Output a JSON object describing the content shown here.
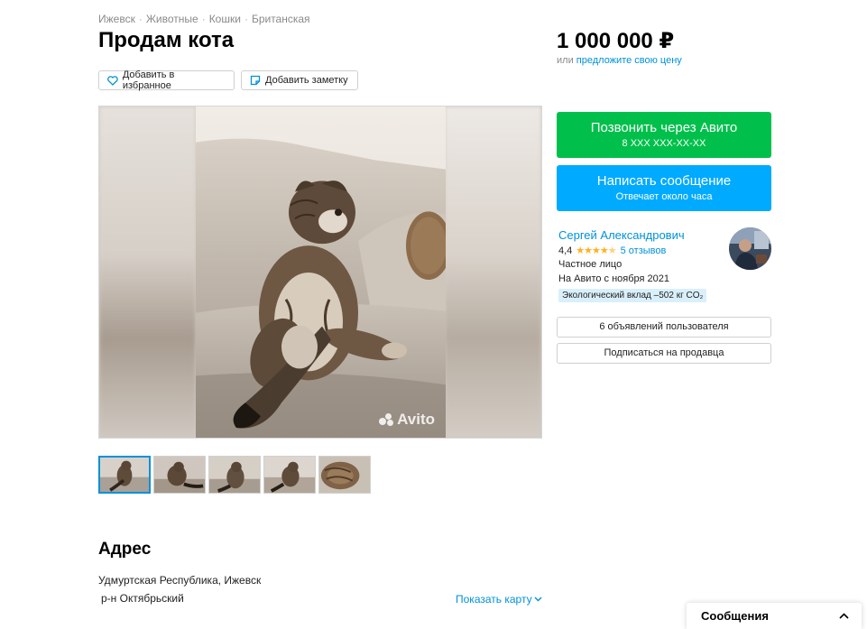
{
  "breadcrumb": [
    "Ижевск",
    "Животные",
    "Кошки",
    "Британская"
  ],
  "listing": {
    "title": "Продам кота",
    "price": "1 000 000 ₽",
    "price_or": "или",
    "price_offer_link": "предложите свою цену"
  },
  "actions": {
    "favorite_label": "Добавить в избранное",
    "note_label": "Добавить заметку"
  },
  "gallery": {
    "watermark": "Avito",
    "thumbnail_count": 5,
    "active_thumbnail": 1
  },
  "contact": {
    "call_label": "Позвонить через Авито",
    "call_phone": "8 XXX XXX-XX-XX",
    "message_label": "Написать сообщение",
    "message_sub": "Отвечает около часа"
  },
  "seller": {
    "name": "Сергей Александрович",
    "rating": "4,4",
    "stars": 4.4,
    "reviews": "5 отзывов",
    "type": "Частное лицо",
    "since": "На Авито с ноября 2021",
    "eco_badge": "Экологический вклад –502 кг CO₂",
    "listings_button": "6 объявлений пользователя",
    "subscribe_button": "Подписаться на продавца"
  },
  "address": {
    "title": "Адрес",
    "line1": "Удмуртская Республика, Ижевск",
    "line2": "р-н Октябрьский",
    "show_map": "Показать карту"
  },
  "messages_widget": {
    "label": "Сообщения"
  },
  "colors": {
    "accent_blue": "#00aaff",
    "link_blue": "#0091d9",
    "call_green": "#00c04b",
    "star_orange": "#ffb021"
  },
  "icons": [
    "heart-icon",
    "note-icon",
    "chevron-down-icon",
    "chevron-up-icon"
  ]
}
